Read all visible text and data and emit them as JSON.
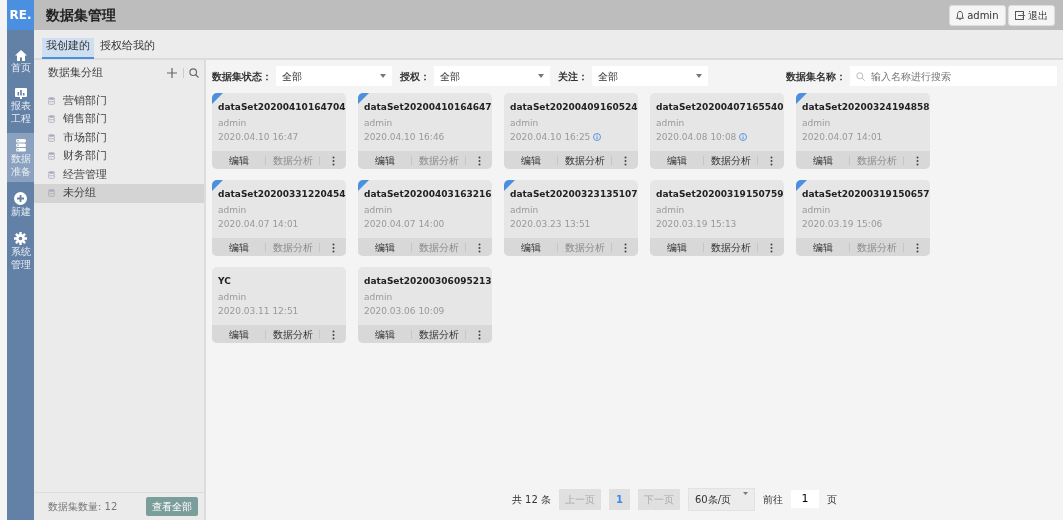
{
  "logo": "RE.",
  "header": {
    "title": "数据集管理",
    "user_button": "admin",
    "logout_button": "退出"
  },
  "nav": [
    {
      "kind": "home",
      "label": "首页",
      "selected": false
    },
    {
      "kind": "report",
      "label": "报表工程",
      "selected": false
    },
    {
      "kind": "data",
      "label": "数据准备",
      "selected": true
    },
    {
      "kind": "new",
      "label": "新建",
      "selected": false
    },
    {
      "kind": "system",
      "label": "系统管理",
      "selected": false
    }
  ],
  "tabs": [
    {
      "label": "我创建的",
      "selected": true
    },
    {
      "label": "授权给我的",
      "selected": false
    }
  ],
  "groups_panel": {
    "title": "数据集分组",
    "groups": [
      {
        "label": "营销部门",
        "selected": false
      },
      {
        "label": "销售部门",
        "selected": false
      },
      {
        "label": "市场部门",
        "selected": false
      },
      {
        "label": "财务部门",
        "selected": false
      },
      {
        "label": "经营管理",
        "selected": false
      },
      {
        "label": "未分组",
        "selected": true
      }
    ],
    "count_text": "数据集数量: 12",
    "view_all_button": "查看全部"
  },
  "filters": [
    {
      "kind": "select",
      "label": "数据集状态：",
      "value": "全部"
    },
    {
      "kind": "select",
      "label": "授权：",
      "value": "全部"
    },
    {
      "kind": "select",
      "label": "关注：",
      "value": "全部"
    },
    {
      "kind": "search",
      "label": "数据集名称：",
      "placeholder": "输入名称进行搜索"
    }
  ],
  "datasets": [
    {
      "name": "dataSet20200410164704",
      "owner": "admin",
      "time": "2020.04.10 16:47",
      "info": false,
      "corner": true,
      "edit": "编辑",
      "analysis": "数据分析",
      "analysis_enabled": false
    },
    {
      "name": "dataSet20200410164647",
      "owner": "admin",
      "time": "2020.04.10 16:46",
      "info": false,
      "corner": true,
      "edit": "编辑",
      "analysis": "数据分析",
      "analysis_enabled": false
    },
    {
      "name": "dataSet20200409160524",
      "owner": "admin",
      "time": "2020.04.10 16:25",
      "info": true,
      "corner": false,
      "edit": "编辑",
      "analysis": "数据分析",
      "analysis_enabled": true
    },
    {
      "name": "dataSet20200407165540",
      "owner": "admin",
      "time": "2020.04.08 10:08",
      "info": true,
      "corner": false,
      "edit": "编辑",
      "analysis": "数据分析",
      "analysis_enabled": true
    },
    {
      "name": "dataSet20200324194858",
      "owner": "admin",
      "time": "2020.04.07 14:01",
      "info": false,
      "corner": true,
      "edit": "编辑",
      "analysis": "数据分析",
      "analysis_enabled": false
    },
    {
      "name": "dataSet20200331220454",
      "owner": "admin",
      "time": "2020.04.07 14:01",
      "info": false,
      "corner": true,
      "edit": "编辑",
      "analysis": "数据分析",
      "analysis_enabled": false
    },
    {
      "name": "dataSet20200403163216",
      "owner": "admin",
      "time": "2020.04.07 14:00",
      "info": false,
      "corner": true,
      "edit": "编辑",
      "analysis": "数据分析",
      "analysis_enabled": false
    },
    {
      "name": "dataSet20200323135107",
      "owner": "admin",
      "time": "2020.03.23 13:51",
      "info": false,
      "corner": true,
      "edit": "编辑",
      "analysis": "数据分析",
      "analysis_enabled": false
    },
    {
      "name": "dataSet20200319150759",
      "owner": "admin",
      "time": "2020.03.19 15:13",
      "info": false,
      "corner": false,
      "edit": "编辑",
      "analysis": "数据分析",
      "analysis_enabled": true
    },
    {
      "name": "dataSet20200319150657",
      "owner": "admin",
      "time": "2020.03.19 15:06",
      "info": false,
      "corner": true,
      "edit": "编辑",
      "analysis": "数据分析",
      "analysis_enabled": false
    },
    {
      "name": "YC",
      "owner": "admin",
      "time": "2020.03.11 12:51",
      "info": false,
      "corner": false,
      "edit": "编辑",
      "analysis": "数据分析",
      "analysis_enabled": true
    },
    {
      "name": "dataSet20200306095213",
      "owner": "admin",
      "time": "2020.03.06 10:09",
      "info": false,
      "corner": false,
      "edit": "编辑",
      "analysis": "数据分析",
      "analysis_enabled": true
    }
  ],
  "pagination": {
    "total": "共 12 条",
    "prev": "上一页",
    "pages": [
      {
        "label": "1",
        "selected": true
      }
    ],
    "next": "下一页",
    "page_size": "60条/页",
    "goto_label": "前往",
    "goto_value": "1",
    "goto_suffix": "页"
  }
}
